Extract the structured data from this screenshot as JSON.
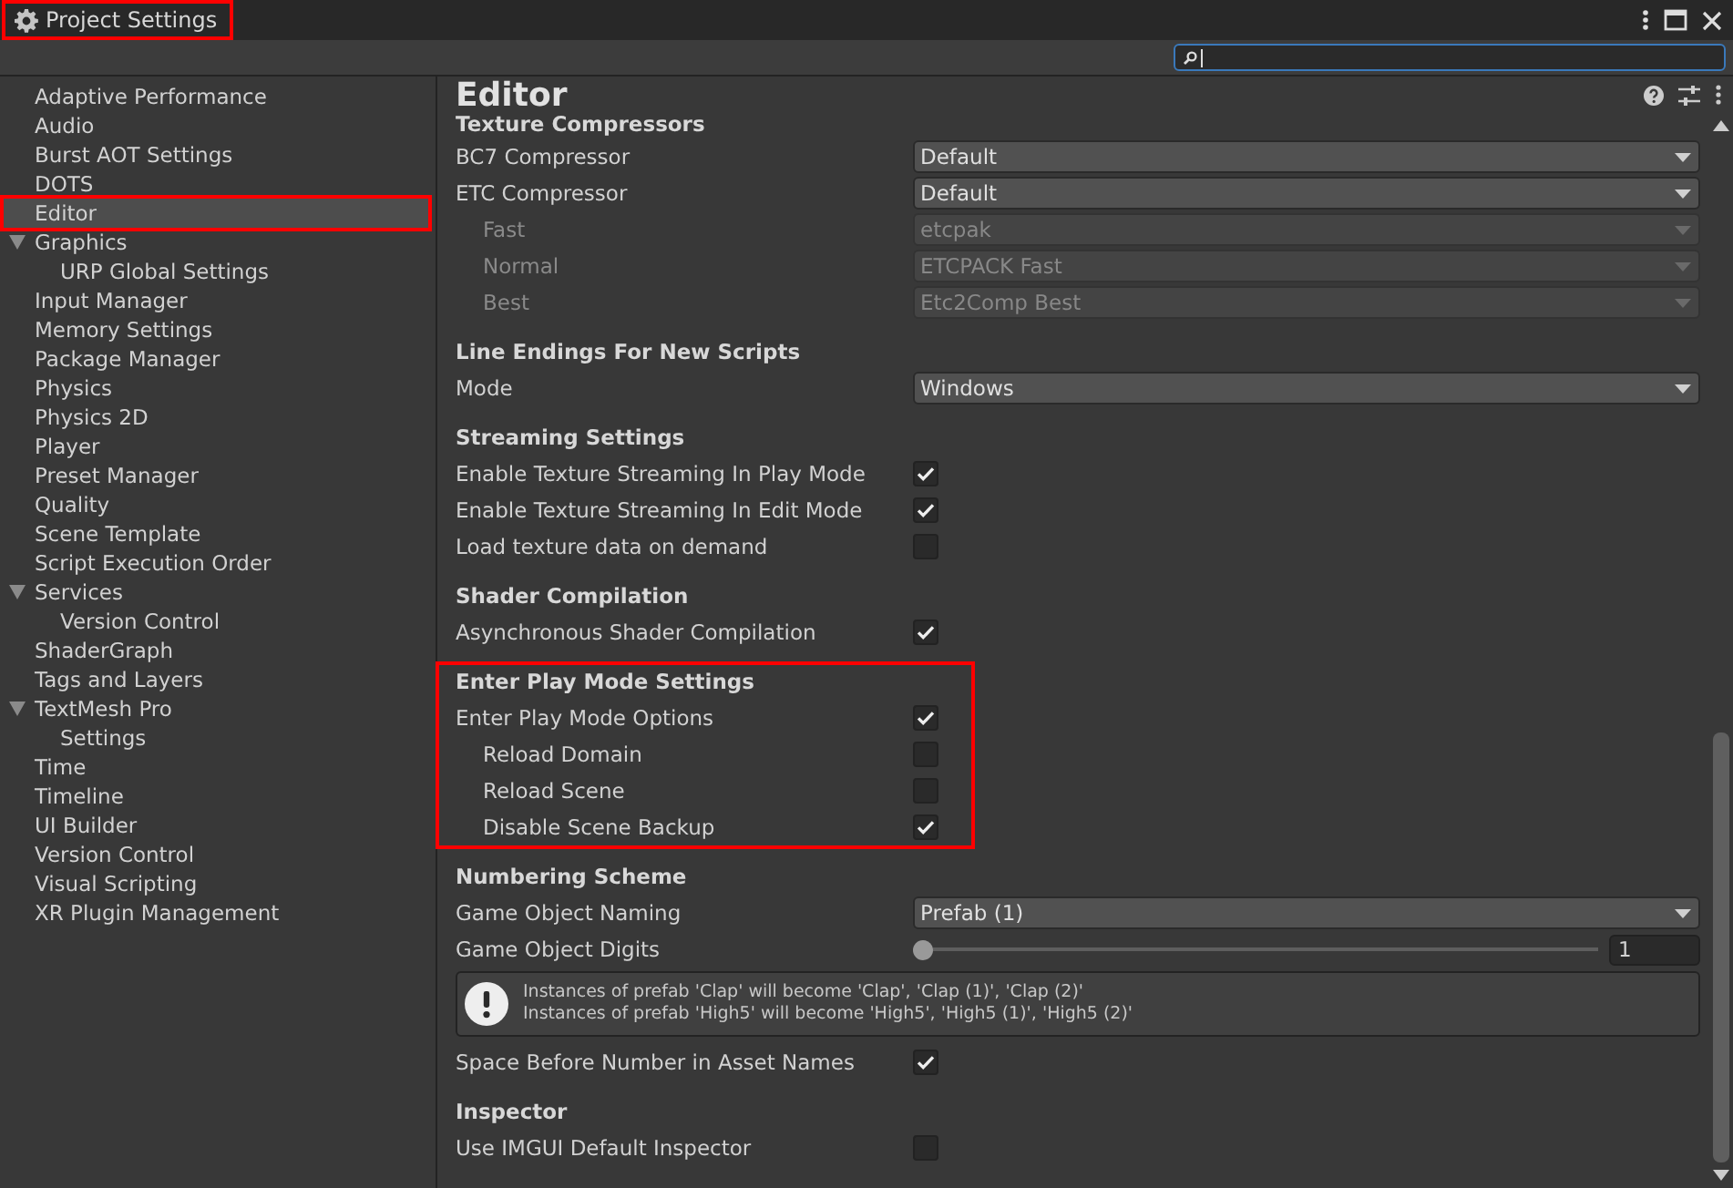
{
  "window": {
    "title": "Project Settings",
    "highlighted": true
  },
  "sidebar": {
    "items": [
      {
        "label": "Adaptive Performance",
        "selected": false,
        "highlighted": false
      },
      {
        "label": "Audio",
        "selected": false,
        "highlighted": false
      },
      {
        "label": "Burst AOT Settings",
        "selected": false,
        "highlighted": false
      },
      {
        "label": "DOTS",
        "selected": false,
        "highlighted": false
      },
      {
        "label": "Editor",
        "selected": true,
        "highlighted": true
      },
      {
        "label": "Graphics",
        "selected": false,
        "highlighted": false,
        "expanded": true,
        "children": [
          {
            "label": "URP Global Settings",
            "selected": false,
            "highlighted": false
          }
        ]
      },
      {
        "label": "Input Manager",
        "selected": false,
        "highlighted": false
      },
      {
        "label": "Memory Settings",
        "selected": false,
        "highlighted": false
      },
      {
        "label": "Package Manager",
        "selected": false,
        "highlighted": false
      },
      {
        "label": "Physics",
        "selected": false,
        "highlighted": false
      },
      {
        "label": "Physics 2D",
        "selected": false,
        "highlighted": false
      },
      {
        "label": "Player",
        "selected": false,
        "highlighted": false
      },
      {
        "label": "Preset Manager",
        "selected": false,
        "highlighted": false
      },
      {
        "label": "Quality",
        "selected": false,
        "highlighted": false
      },
      {
        "label": "Scene Template",
        "selected": false,
        "highlighted": false
      },
      {
        "label": "Script Execution Order",
        "selected": false,
        "highlighted": false
      },
      {
        "label": "Services",
        "selected": false,
        "highlighted": false,
        "expanded": true,
        "children": [
          {
            "label": "Version Control",
            "selected": false,
            "highlighted": false
          }
        ]
      },
      {
        "label": "ShaderGraph",
        "selected": false,
        "highlighted": false
      },
      {
        "label": "Tags and Layers",
        "selected": false,
        "highlighted": false
      },
      {
        "label": "TextMesh Pro",
        "selected": false,
        "highlighted": false,
        "expanded": true,
        "children": [
          {
            "label": "Settings",
            "selected": false,
            "highlighted": false
          }
        ]
      },
      {
        "label": "Time",
        "selected": false,
        "highlighted": false
      },
      {
        "label": "Timeline",
        "selected": false,
        "highlighted": false
      },
      {
        "label": "UI Builder",
        "selected": false,
        "highlighted": false
      },
      {
        "label": "Version Control",
        "selected": false,
        "highlighted": false
      },
      {
        "label": "Visual Scripting",
        "selected": false,
        "highlighted": false
      },
      {
        "label": "XR Plugin Management",
        "selected": false,
        "highlighted": false
      }
    ]
  },
  "inspector": {
    "title": "Editor",
    "sections": [
      {
        "heading": "Texture Compressors",
        "highlighted": false,
        "rows": [
          {
            "kind": "dropdown",
            "label": "BC7 Compressor",
            "value": "Default",
            "indented": false,
            "disabled": false
          },
          {
            "kind": "dropdown",
            "label": "ETC Compressor",
            "value": "Default",
            "indented": false,
            "disabled": false
          },
          {
            "kind": "dropdown",
            "label": "Fast",
            "value": "etcpak",
            "indented": true,
            "disabled": true
          },
          {
            "kind": "dropdown",
            "label": "Normal",
            "value": "ETCPACK Fast",
            "indented": true,
            "disabled": true
          },
          {
            "kind": "dropdown",
            "label": "Best",
            "value": "Etc2Comp Best",
            "indented": true,
            "disabled": true
          }
        ]
      },
      {
        "heading": "Line Endings For New Scripts",
        "highlighted": false,
        "rows": [
          {
            "kind": "dropdown",
            "label": "Mode",
            "value": "Windows",
            "indented": false,
            "disabled": false
          }
        ]
      },
      {
        "heading": "Streaming Settings",
        "highlighted": false,
        "rows": [
          {
            "kind": "checkbox",
            "label": "Enable Texture Streaming In Play Mode",
            "checked": true,
            "indented": false
          },
          {
            "kind": "checkbox",
            "label": "Enable Texture Streaming In Edit Mode",
            "checked": true,
            "indented": false
          },
          {
            "kind": "checkbox",
            "label": "Load texture data on demand",
            "checked": false,
            "indented": false
          }
        ]
      },
      {
        "heading": "Shader Compilation",
        "highlighted": false,
        "rows": [
          {
            "kind": "checkbox",
            "label": "Asynchronous Shader Compilation",
            "checked": true,
            "indented": false
          }
        ]
      },
      {
        "heading": "Enter Play Mode Settings",
        "highlighted": true,
        "rows": [
          {
            "kind": "checkbox",
            "label": "Enter Play Mode Options",
            "checked": true,
            "indented": false
          },
          {
            "kind": "checkbox",
            "label": "Reload Domain",
            "checked": false,
            "indented": true
          },
          {
            "kind": "checkbox",
            "label": "Reload Scene",
            "checked": false,
            "indented": true
          },
          {
            "kind": "checkbox",
            "label": "Disable Scene Backup",
            "checked": true,
            "indented": true
          }
        ]
      },
      {
        "heading": "Numbering Scheme",
        "highlighted": false,
        "rows": [
          {
            "kind": "dropdown",
            "label": "Game Object Naming",
            "value": "Prefab (1)",
            "indented": false,
            "disabled": false
          },
          {
            "kind": "slider",
            "label": "Game Object Digits",
            "value": "1",
            "level": 0,
            "indented": false
          },
          {
            "kind": "help",
            "lines": [
              "Instances of prefab 'Clap' will become 'Clap', 'Clap (1)', 'Clap (2)'",
              "Instances of prefab 'High5' will become 'High5', 'High5 (1)', 'High5 (2)'"
            ]
          },
          {
            "kind": "checkbox",
            "label": "Space Before Number in Asset Names",
            "checked": true,
            "indented": false
          }
        ]
      },
      {
        "heading": "Inspector",
        "highlighted": false,
        "rows": [
          {
            "kind": "checkbox",
            "label": "Use IMGUI Default Inspector",
            "checked": false,
            "indented": false
          }
        ]
      }
    ]
  }
}
